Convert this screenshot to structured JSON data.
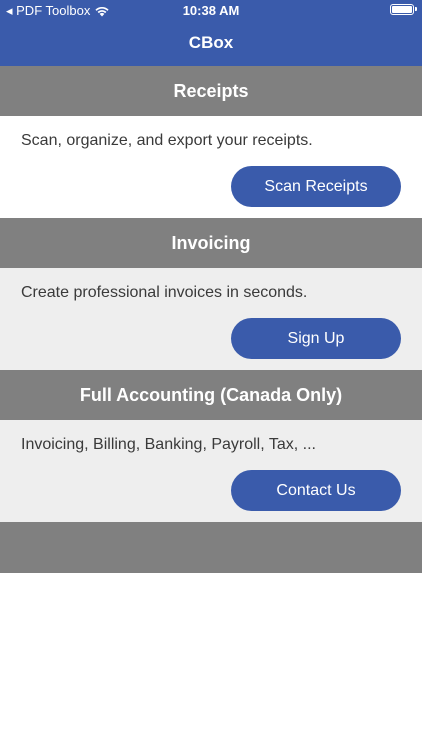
{
  "status_bar": {
    "carrier": "◂ PDF Toolbox",
    "time": "10:38 AM"
  },
  "nav": {
    "title": "CBox"
  },
  "sections": [
    {
      "title": "Receipts",
      "description": "Scan, organize, and export your receipts.",
      "button_label": "Scan Receipts"
    },
    {
      "title": "Invoicing",
      "description": "Create professional invoices in seconds.",
      "button_label": "Sign Up"
    },
    {
      "title": "Full Accounting (Canada Only)",
      "description": "Invoicing, Billing, Banking, Payroll, Tax, ...",
      "button_label": "Contact Us"
    }
  ],
  "colors": {
    "nav_bar": "#3a5bab",
    "section_header": "#808080",
    "button": "#3a5bab"
  },
  "icons": {
    "wifi": "wifi-icon",
    "battery": "battery-icon"
  }
}
